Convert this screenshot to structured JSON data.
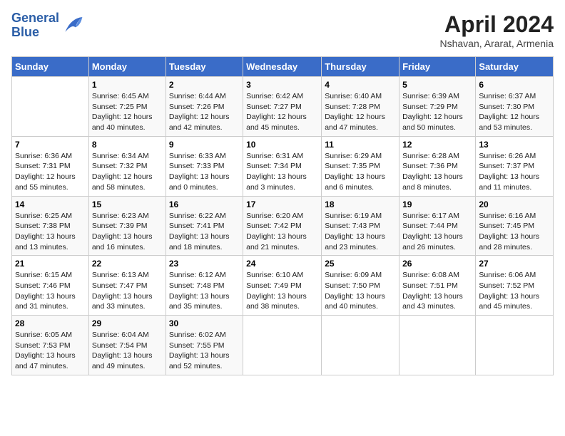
{
  "header": {
    "logo_line1": "General",
    "logo_line2": "Blue",
    "month_title": "April 2024",
    "location": "Nshavan, Ararat, Armenia"
  },
  "days_of_week": [
    "Sunday",
    "Monday",
    "Tuesday",
    "Wednesday",
    "Thursday",
    "Friday",
    "Saturday"
  ],
  "weeks": [
    [
      {
        "day": "",
        "info": ""
      },
      {
        "day": "1",
        "info": "Sunrise: 6:45 AM\nSunset: 7:25 PM\nDaylight: 12 hours\nand 40 minutes."
      },
      {
        "day": "2",
        "info": "Sunrise: 6:44 AM\nSunset: 7:26 PM\nDaylight: 12 hours\nand 42 minutes."
      },
      {
        "day": "3",
        "info": "Sunrise: 6:42 AM\nSunset: 7:27 PM\nDaylight: 12 hours\nand 45 minutes."
      },
      {
        "day": "4",
        "info": "Sunrise: 6:40 AM\nSunset: 7:28 PM\nDaylight: 12 hours\nand 47 minutes."
      },
      {
        "day": "5",
        "info": "Sunrise: 6:39 AM\nSunset: 7:29 PM\nDaylight: 12 hours\nand 50 minutes."
      },
      {
        "day": "6",
        "info": "Sunrise: 6:37 AM\nSunset: 7:30 PM\nDaylight: 12 hours\nand 53 minutes."
      }
    ],
    [
      {
        "day": "7",
        "info": "Sunrise: 6:36 AM\nSunset: 7:31 PM\nDaylight: 12 hours\nand 55 minutes."
      },
      {
        "day": "8",
        "info": "Sunrise: 6:34 AM\nSunset: 7:32 PM\nDaylight: 12 hours\nand 58 minutes."
      },
      {
        "day": "9",
        "info": "Sunrise: 6:33 AM\nSunset: 7:33 PM\nDaylight: 13 hours\nand 0 minutes."
      },
      {
        "day": "10",
        "info": "Sunrise: 6:31 AM\nSunset: 7:34 PM\nDaylight: 13 hours\nand 3 minutes."
      },
      {
        "day": "11",
        "info": "Sunrise: 6:29 AM\nSunset: 7:35 PM\nDaylight: 13 hours\nand 6 minutes."
      },
      {
        "day": "12",
        "info": "Sunrise: 6:28 AM\nSunset: 7:36 PM\nDaylight: 13 hours\nand 8 minutes."
      },
      {
        "day": "13",
        "info": "Sunrise: 6:26 AM\nSunset: 7:37 PM\nDaylight: 13 hours\nand 11 minutes."
      }
    ],
    [
      {
        "day": "14",
        "info": "Sunrise: 6:25 AM\nSunset: 7:38 PM\nDaylight: 13 hours\nand 13 minutes."
      },
      {
        "day": "15",
        "info": "Sunrise: 6:23 AM\nSunset: 7:39 PM\nDaylight: 13 hours\nand 16 minutes."
      },
      {
        "day": "16",
        "info": "Sunrise: 6:22 AM\nSunset: 7:41 PM\nDaylight: 13 hours\nand 18 minutes."
      },
      {
        "day": "17",
        "info": "Sunrise: 6:20 AM\nSunset: 7:42 PM\nDaylight: 13 hours\nand 21 minutes."
      },
      {
        "day": "18",
        "info": "Sunrise: 6:19 AM\nSunset: 7:43 PM\nDaylight: 13 hours\nand 23 minutes."
      },
      {
        "day": "19",
        "info": "Sunrise: 6:17 AM\nSunset: 7:44 PM\nDaylight: 13 hours\nand 26 minutes."
      },
      {
        "day": "20",
        "info": "Sunrise: 6:16 AM\nSunset: 7:45 PM\nDaylight: 13 hours\nand 28 minutes."
      }
    ],
    [
      {
        "day": "21",
        "info": "Sunrise: 6:15 AM\nSunset: 7:46 PM\nDaylight: 13 hours\nand 31 minutes."
      },
      {
        "day": "22",
        "info": "Sunrise: 6:13 AM\nSunset: 7:47 PM\nDaylight: 13 hours\nand 33 minutes."
      },
      {
        "day": "23",
        "info": "Sunrise: 6:12 AM\nSunset: 7:48 PM\nDaylight: 13 hours\nand 35 minutes."
      },
      {
        "day": "24",
        "info": "Sunrise: 6:10 AM\nSunset: 7:49 PM\nDaylight: 13 hours\nand 38 minutes."
      },
      {
        "day": "25",
        "info": "Sunrise: 6:09 AM\nSunset: 7:50 PM\nDaylight: 13 hours\nand 40 minutes."
      },
      {
        "day": "26",
        "info": "Sunrise: 6:08 AM\nSunset: 7:51 PM\nDaylight: 13 hours\nand 43 minutes."
      },
      {
        "day": "27",
        "info": "Sunrise: 6:06 AM\nSunset: 7:52 PM\nDaylight: 13 hours\nand 45 minutes."
      }
    ],
    [
      {
        "day": "28",
        "info": "Sunrise: 6:05 AM\nSunset: 7:53 PM\nDaylight: 13 hours\nand 47 minutes."
      },
      {
        "day": "29",
        "info": "Sunrise: 6:04 AM\nSunset: 7:54 PM\nDaylight: 13 hours\nand 49 minutes."
      },
      {
        "day": "30",
        "info": "Sunrise: 6:02 AM\nSunset: 7:55 PM\nDaylight: 13 hours\nand 52 minutes."
      },
      {
        "day": "",
        "info": ""
      },
      {
        "day": "",
        "info": ""
      },
      {
        "day": "",
        "info": ""
      },
      {
        "day": "",
        "info": ""
      }
    ]
  ]
}
